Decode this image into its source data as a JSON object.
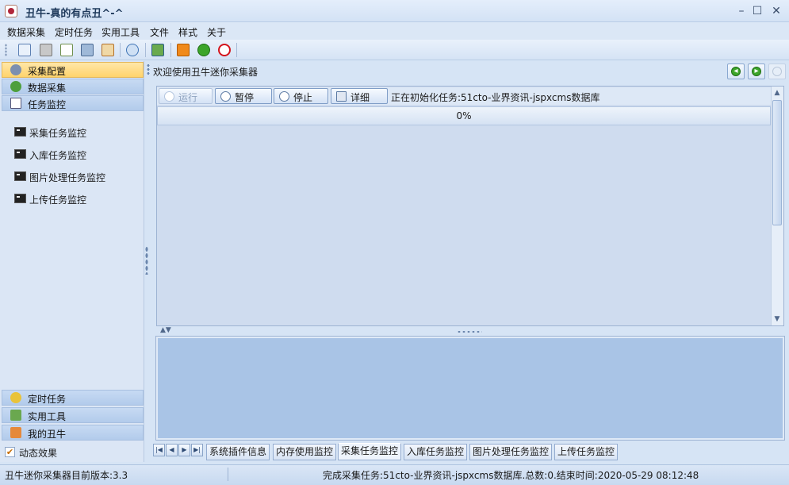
{
  "window": {
    "title": "丑牛-真的有点丑^-^",
    "minimize": "–",
    "maximize": "☐",
    "close": "✕"
  },
  "menu": [
    "数据采集",
    "定时任务",
    "实用工具",
    "文件",
    "样式",
    "关于"
  ],
  "toolbar": {
    "icons": [
      "new-task-icon",
      "print-icon",
      "add-document-icon",
      "server-icon",
      "database-icon",
      "refresh-settings-icon",
      "image-icon",
      "rss-icon",
      "download-icon",
      "stop-icon"
    ]
  },
  "sidebar": {
    "top_groups": [
      {
        "label": "采集配置",
        "icon": "gear-icon",
        "active": true
      },
      {
        "label": "数据采集",
        "icon": "globe-icon",
        "active": false
      },
      {
        "label": "任务监控",
        "icon": "monitor-icon",
        "active": false
      }
    ],
    "tree_items": [
      {
        "label": "采集任务监控",
        "icon": "console-icon"
      },
      {
        "label": "入库任务监控",
        "icon": "console-icon"
      },
      {
        "label": "图片处理任务监控",
        "icon": "console-icon"
      },
      {
        "label": "上传任务监控",
        "icon": "console-icon"
      }
    ],
    "bottom_groups": [
      {
        "label": "定时任务",
        "icon": "clock-icon"
      },
      {
        "label": "实用工具",
        "icon": "tools-icon"
      },
      {
        "label": "我的丑牛",
        "icon": "home-icon"
      }
    ],
    "dynamic_effect": {
      "label": "动态效果",
      "checked": true
    }
  },
  "content": {
    "welcome": "欢迎使用丑牛迷你采集器",
    "header_buttons": [
      "back-icon",
      "forward-icon",
      "disabled-icon"
    ],
    "task_buttons": [
      {
        "label": "运行",
        "icon": "play-icon",
        "enabled": false
      },
      {
        "label": "暂停",
        "icon": "pause-icon",
        "enabled": true
      },
      {
        "label": "停止",
        "icon": "stop-icon",
        "enabled": true
      },
      {
        "label": "详细",
        "icon": "details-icon",
        "enabled": true
      }
    ],
    "task_status": "正在初始化任务:51cto-业界资讯-jspxcms数据库",
    "progress_text": "0%",
    "progress_value": 0
  },
  "tabs": {
    "nav": [
      "|◀",
      "◀",
      "▶",
      "▶|"
    ],
    "items": [
      {
        "label": "系统插件信息",
        "active": false
      },
      {
        "label": "内存使用监控",
        "active": false
      },
      {
        "label": "采集任务监控",
        "active": true
      },
      {
        "label": "入库任务监控",
        "active": false
      },
      {
        "label": "图片处理任务监控",
        "active": false
      },
      {
        "label": "上传任务监控",
        "active": false
      }
    ]
  },
  "status": {
    "left": "丑牛迷你采集器目前版本:3.3",
    "right": "完成采集任务:51cto-业界资讯-jspxcms数据库.总数:0.结束时间:2020-05-29 08:12:48"
  },
  "colors": {
    "active_nav": "#ffd36b",
    "accent_blue": "#b2cbeb",
    "log_panel": "#a9c4e6"
  }
}
